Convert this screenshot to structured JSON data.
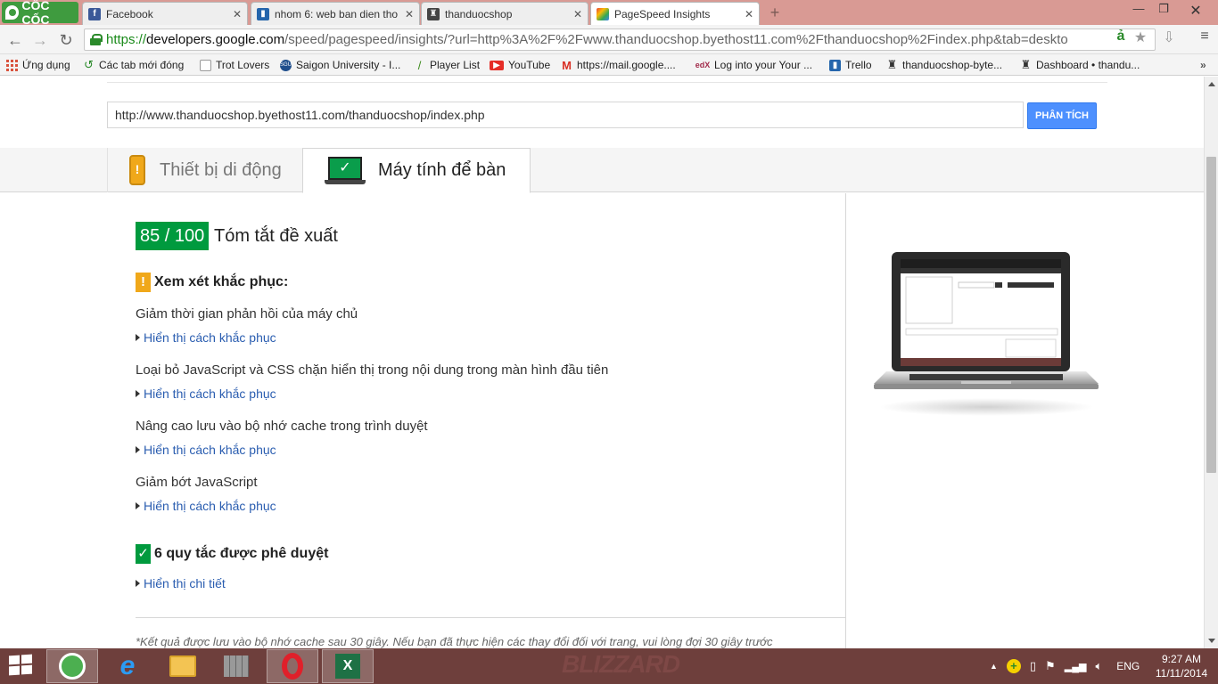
{
  "browser": {
    "logo_text": "CỐC CỐC",
    "tabs": [
      {
        "label": "Facebook",
        "icon": "facebook-icon",
        "color": "#3b5998"
      },
      {
        "label": "nhom 6: web ban dien tho",
        "icon": "trello-icon",
        "color": "#2565ac"
      },
      {
        "label": "thanduocshop",
        "icon": "byethost-icon",
        "color": "#444444"
      },
      {
        "label": "PageSpeed Insights",
        "icon": "pagespeed-icon",
        "color": "#4d90fe"
      }
    ],
    "url_scheme": "https://",
    "url_host": "developers.google.com",
    "url_rest": "/speed/pagespeed/insights/?url=http%3A%2F%2Fwww.thanduocshop.byethost11.com%2Fthanduocshop%2Findex.php&tab=deskto"
  },
  "bookmarks": [
    {
      "label": "Ứng dụng",
      "icon": "apps-icon"
    },
    {
      "label": "Các tab mới đóng",
      "icon": "recent-tabs-icon"
    },
    {
      "label": "Trot Lovers",
      "icon": "page-icon"
    },
    {
      "label": "Saigon University - I...",
      "icon": "university-icon"
    },
    {
      "label": "Player List",
      "icon": "feather-icon"
    },
    {
      "label": "YouTube",
      "icon": "youtube-icon"
    },
    {
      "label": "https://mail.google....",
      "icon": "gmail-icon"
    },
    {
      "label": "Log into your Your ...",
      "icon": "edx-icon"
    },
    {
      "label": "Trello",
      "icon": "trello-icon"
    },
    {
      "label": "thanduocshop-byte...",
      "icon": "byethost-icon"
    },
    {
      "label": "Dashboard • thandu...",
      "icon": "byethost-icon"
    }
  ],
  "analysis": {
    "url_value": "http://www.thanduocshop.byethost11.com/thanduocshop/index.php",
    "analyze_button": "PHÂN TÍCH"
  },
  "device_tabs": {
    "mobile": "Thiết bị di động",
    "desktop": "Máy tính để bàn"
  },
  "report": {
    "score": "85 / 100",
    "summary_title": "Tóm tắt đề xuất",
    "warning_heading": "Xem xét khắc phục:",
    "rules": [
      {
        "title": "Giảm thời gian phản hồi của máy chủ",
        "link": "Hiển thị cách khắc phục"
      },
      {
        "title": "Loại bỏ JavaScript và CSS chặn hiển thị trong nội dung trong màn hình đầu tiên",
        "link": "Hiển thị cách khắc phục"
      },
      {
        "title": "Nâng cao lưu vào bộ nhớ cache trong trình duyệt",
        "link": "Hiển thị cách khắc phục"
      },
      {
        "title": "Giảm bớt JavaScript",
        "link": "Hiển thị cách khắc phục"
      }
    ],
    "passed_heading": "6 quy tắc được phê duyệt",
    "passed_link": "Hiển thị chi tiết",
    "footnote": "*Kết quả được lưu vào bộ nhớ cache sau 30 giây. Nếu bạn đã thực hiện các thay đổi đối với trang, vui lòng đợi 30 giây trước"
  },
  "taskbar": {
    "watermark": "BLIZZARD",
    "language": "ENG",
    "time": "9:27 AM",
    "date": "11/11/2014"
  },
  "colors": {
    "score_green": "#009a3e",
    "warning_orange": "#f0a81a",
    "link_blue": "#2a5db0",
    "button_blue": "#4d90fe",
    "taskbar_bg": "#6e3f3c",
    "tabstrip_bg": "#d99a94"
  }
}
